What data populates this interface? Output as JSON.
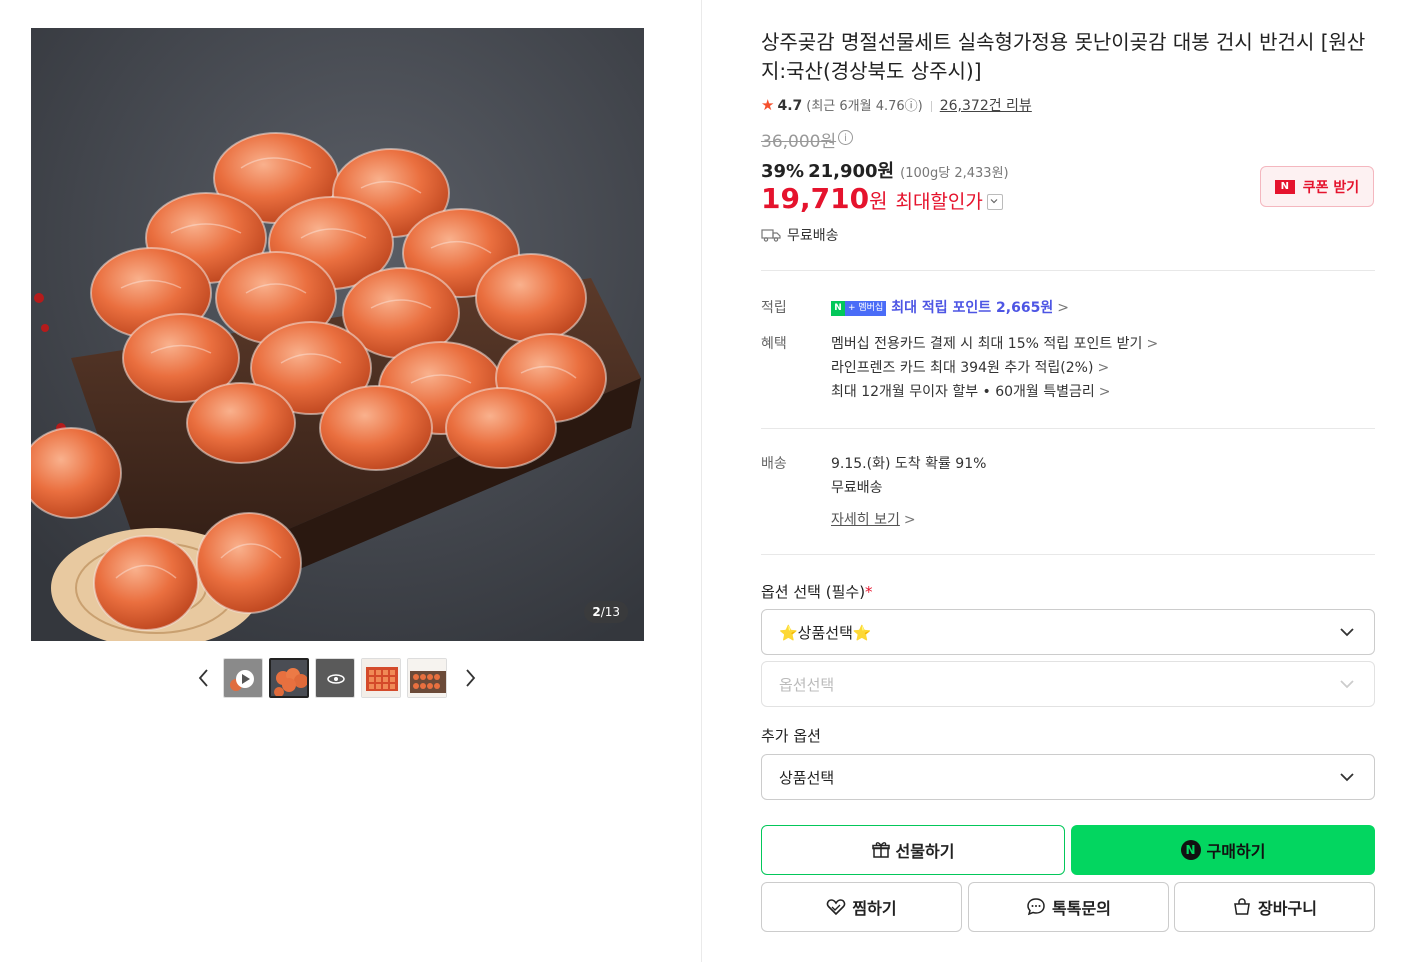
{
  "gallery": {
    "counter_current": "2",
    "counter_total": "/13",
    "prev_icon": "chevron-left-icon",
    "next_icon": "chevron-right-icon",
    "thumbnails": [
      "video-thumb",
      "persimmon-pile",
      "view-360",
      "gift-box-grid",
      "gift-box-open"
    ]
  },
  "product": {
    "title": "상주곶감 명절선물세트 실속형가정용 못난이곶감 대봉 건시 반건시 [원산지:국산(경상북도 상주시)]",
    "rating_star": "★",
    "rating": "4.7",
    "recent_rating": "(최근 6개월 4.76ⓘ)",
    "reviews": "26,372건 리뷰",
    "original_price": "36,000원",
    "discount_rate": "39%",
    "sale_price": "21,900원",
    "unit_price": "(100g당 2,433원)",
    "max_discount_amount": "19,710",
    "max_discount_won": "원",
    "max_discount_label": "최대할인가",
    "coupon_button": "쿠폰 받기",
    "coupon_badge": "N",
    "free_shipping": "무료배송"
  },
  "benefits": {
    "points_label": "적립",
    "points_badge_n": "N",
    "points_badge_plus": "+ 멤버십",
    "points_text": "최대 적립 포인트 2,665원",
    "perks_label": "혜택",
    "perks": [
      "멤버십 전용카드 결제 시 최대 15% 적립 포인트 받기",
      "라인프렌즈 카드 최대 394원 추가 적립(2%)",
      "최대 12개월 무이자 할부 • 60개월 특별금리"
    ],
    "gt": ">"
  },
  "delivery": {
    "label": "배송",
    "arrival": "9.15.(화) 도착 확률 91%",
    "fee": "무료배송",
    "details_link": "자세히 보기"
  },
  "options": {
    "required_label": "옵션 선택 (필수)",
    "required_mark": "*",
    "product_select": "⭐상품선택⭐",
    "option_select_placeholder": "옵션선택",
    "extra_label": "추가 옵션",
    "extra_select": "상품선택"
  },
  "actions": {
    "gift": "선물하기",
    "buy": "구매하기",
    "buy_logo": "N",
    "wish": "찜하기",
    "talk": "톡톡문의",
    "cart": "장바구니"
  },
  "colors": {
    "accent_green": "#03d660",
    "price_red": "#e5132d",
    "point_blue": "#4d55e4"
  }
}
